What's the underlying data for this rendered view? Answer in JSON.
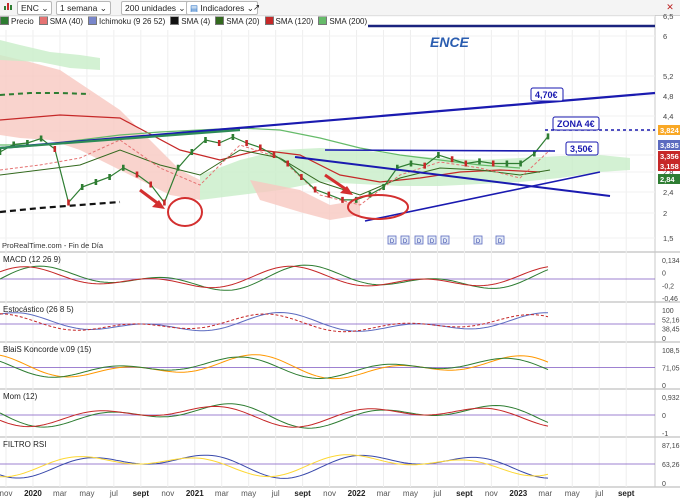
{
  "toolbar": {
    "symbol": "ENC",
    "timeframe": "1 semana",
    "units": "200 unidades",
    "indicators_label": "Indicadores",
    "close_glyph": "✕"
  },
  "legend": [
    {
      "label": "Precio",
      "color": "#2e7d32"
    },
    {
      "label": "SMA (40)",
      "color": "#e57373"
    },
    {
      "label": "Ichimoku (9 26 52)",
      "color": "#7986cb"
    },
    {
      "label": "SMA (4)",
      "color": "#111111"
    },
    {
      "label": "SMA (20)",
      "color": "#33691e"
    },
    {
      "label": "SMA (120)",
      "color": "#c62828"
    },
    {
      "label": "SMA (200)",
      "color": "#66bb6a"
    }
  ],
  "chart_data": {
    "type": "line",
    "title": "ENCE",
    "x_ticks": [
      "nov",
      "2020",
      "mar",
      "may",
      "jul",
      "sept",
      "nov",
      "2021",
      "mar",
      "may",
      "jul",
      "sept",
      "nov",
      "2022",
      "mar",
      "may",
      "jul",
      "sept",
      "nov",
      "2023",
      "mar",
      "may",
      "jul",
      "sept"
    ],
    "y_ticks": [
      "6,5",
      "6",
      "5,2",
      "4,8",
      "4,4",
      "4",
      "3,2",
      "2,8",
      "2,4",
      "2",
      "1,5"
    ],
    "y_price_labels": [
      "3,824",
      "3,835",
      "3,356",
      "3,158",
      "2,84"
    ],
    "annotations": [
      "ENCE",
      "4,70€",
      "ZONA 4€",
      "3,50€"
    ],
    "source": "ProRealTime.com - Fin de Día",
    "price": {
      "x": [
        "2019-10",
        "2019-11",
        "2019-12",
        "2020-01",
        "2020-02",
        "2020-03",
        "2020-04",
        "2020-05",
        "2020-06",
        "2020-07",
        "2020-08",
        "2020-09",
        "2020-10",
        "2020-11",
        "2020-12",
        "2021-01",
        "2021-02",
        "2021-03",
        "2021-04",
        "2021-05",
        "2021-06",
        "2021-07",
        "2021-08",
        "2021-09",
        "2021-10",
        "2021-11",
        "2021-12",
        "2022-01",
        "2022-02",
        "2022-03",
        "2022-04",
        "2022-05",
        "2022-06",
        "2022-07",
        "2022-08",
        "2022-09",
        "2022-10",
        "2022-11",
        "2022-12",
        "2023-01",
        "2023-02"
      ],
      "close": [
        3.3,
        3.55,
        3.6,
        3.75,
        3.4,
        2.2,
        2.5,
        2.6,
        2.7,
        2.9,
        2.75,
        2.55,
        2.2,
        2.9,
        3.3,
        3.7,
        3.6,
        3.8,
        3.6,
        3.45,
        3.2,
        3.0,
        2.7,
        2.45,
        2.35,
        2.25,
        2.25,
        2.35,
        2.5,
        2.9,
        3.0,
        2.95,
        3.2,
        3.1,
        3.0,
        3.05,
        3.0,
        3.0,
        3.0,
        3.25,
        3.82
      ]
    },
    "sub_panels": [
      {
        "name": "MACD (12 26 9)",
        "ticks": [
          "0,134",
          "0",
          "-0,2",
          "-0,46"
        ]
      },
      {
        "name": "Estocástico (26 8 5)",
        "ticks": [
          "100",
          "52,16",
          "38,45",
          "0"
        ]
      },
      {
        "name": "BlaiS Koncorde v.09 (15)",
        "ticks": [
          "108,5",
          "71,05",
          "0"
        ]
      },
      {
        "name": "Mom (12)",
        "ticks": [
          "0,932",
          "0",
          "-1"
        ]
      },
      {
        "name": "FILTRO RSI",
        "ticks": [
          "87,16",
          "63,26",
          "0"
        ]
      }
    ]
  }
}
